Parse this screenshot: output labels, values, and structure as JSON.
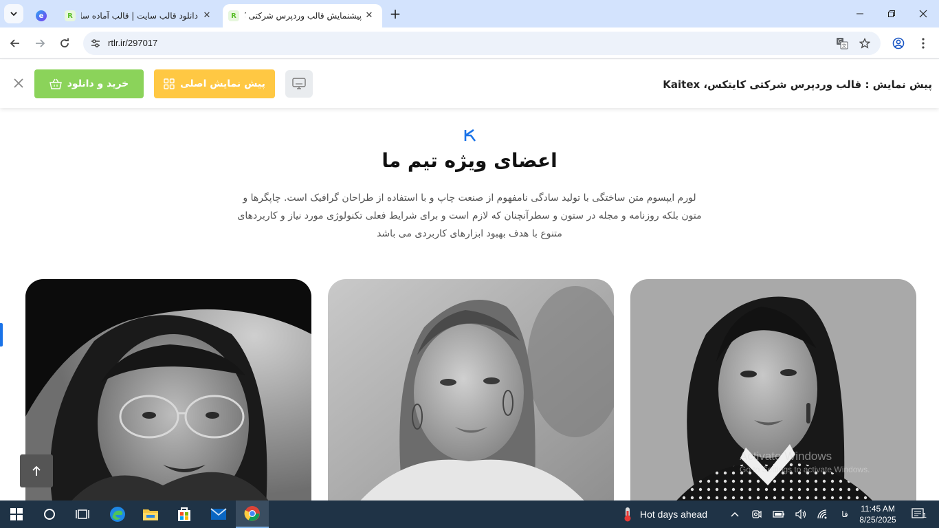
{
  "browser": {
    "tabs": [
      {
        "title": "",
        "favicon": "edge-copilot-icon"
      },
      {
        "title": "دانلود قالب سایت | قالب آماده سا",
        "favicon": "rtl-theme-icon"
      },
      {
        "title": "پیشنمایش قالب وردپرس شرکتی کا",
        "favicon": "rtl-theme-icon",
        "active": true
      }
    ],
    "url": "rtlr.ir/297017"
  },
  "preview": {
    "title": "پیش نمایش : قالب وردپرس شرکتی کایتکس، Kaitex",
    "demo_label": "پیش نمایش اصلی",
    "buy_label": "خرید و دانلود"
  },
  "section": {
    "title": "اعضای ویژه تیم ما",
    "description": "لورم ایپسوم متن ساختگی با تولید سادگی نامفهوم از صنعت چاپ و با استفاده از طراحان گرافیک است. چاپگرها و متون بلکه روزنامه و مجله در ستون و سطرآنچنان که لازم است و برای شرایط فعلی تکنولوژی مورد نیاز و کاربردهای متنوع با هدف بهبود ابزارهای کاربردی می باشد"
  },
  "watermark": {
    "title": "Activate Windows",
    "subtitle": "Go to Settings to activate Windows."
  },
  "taskbar": {
    "weather": "Hot days ahead",
    "language": "فا",
    "time": "11:45 AM",
    "date": "8/25/2025",
    "notifications": "1"
  },
  "colors": {
    "brand_blue": "#1a73e8",
    "demo_yellow": "#ffc843",
    "buy_green": "#8bd35a",
    "tabbar": "#d3e3fd",
    "taskbar": "#1f3346"
  }
}
